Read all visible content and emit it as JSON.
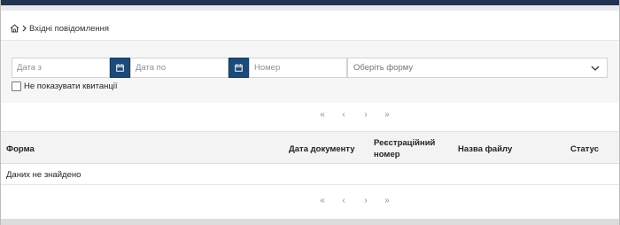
{
  "breadcrumb": {
    "home_icon": "home-icon",
    "separator_icon": "chevron-right-icon",
    "current": "Вхідні повідомлення"
  },
  "filters": {
    "date_from_placeholder": "Дата з",
    "date_to_placeholder": "Дата по",
    "number_placeholder": "Номер",
    "form_select_placeholder": "Оберіть форму",
    "hide_receipts_label": "Не показувати квитанції",
    "hide_receipts_checked": false
  },
  "pagination": {
    "first": "«",
    "prev": "‹",
    "next": "›",
    "last": "»"
  },
  "table": {
    "columns": {
      "form": "Форма",
      "doc_date": "Дата документу",
      "reg_number_line1": "Реєстраційний",
      "reg_number_line2": "номер",
      "file_name": "Назва файлу",
      "status": "Статус"
    },
    "empty_message": "Даних не знайдено"
  },
  "colors": {
    "accent": "#1c4a79",
    "topbar": "#22344f"
  }
}
